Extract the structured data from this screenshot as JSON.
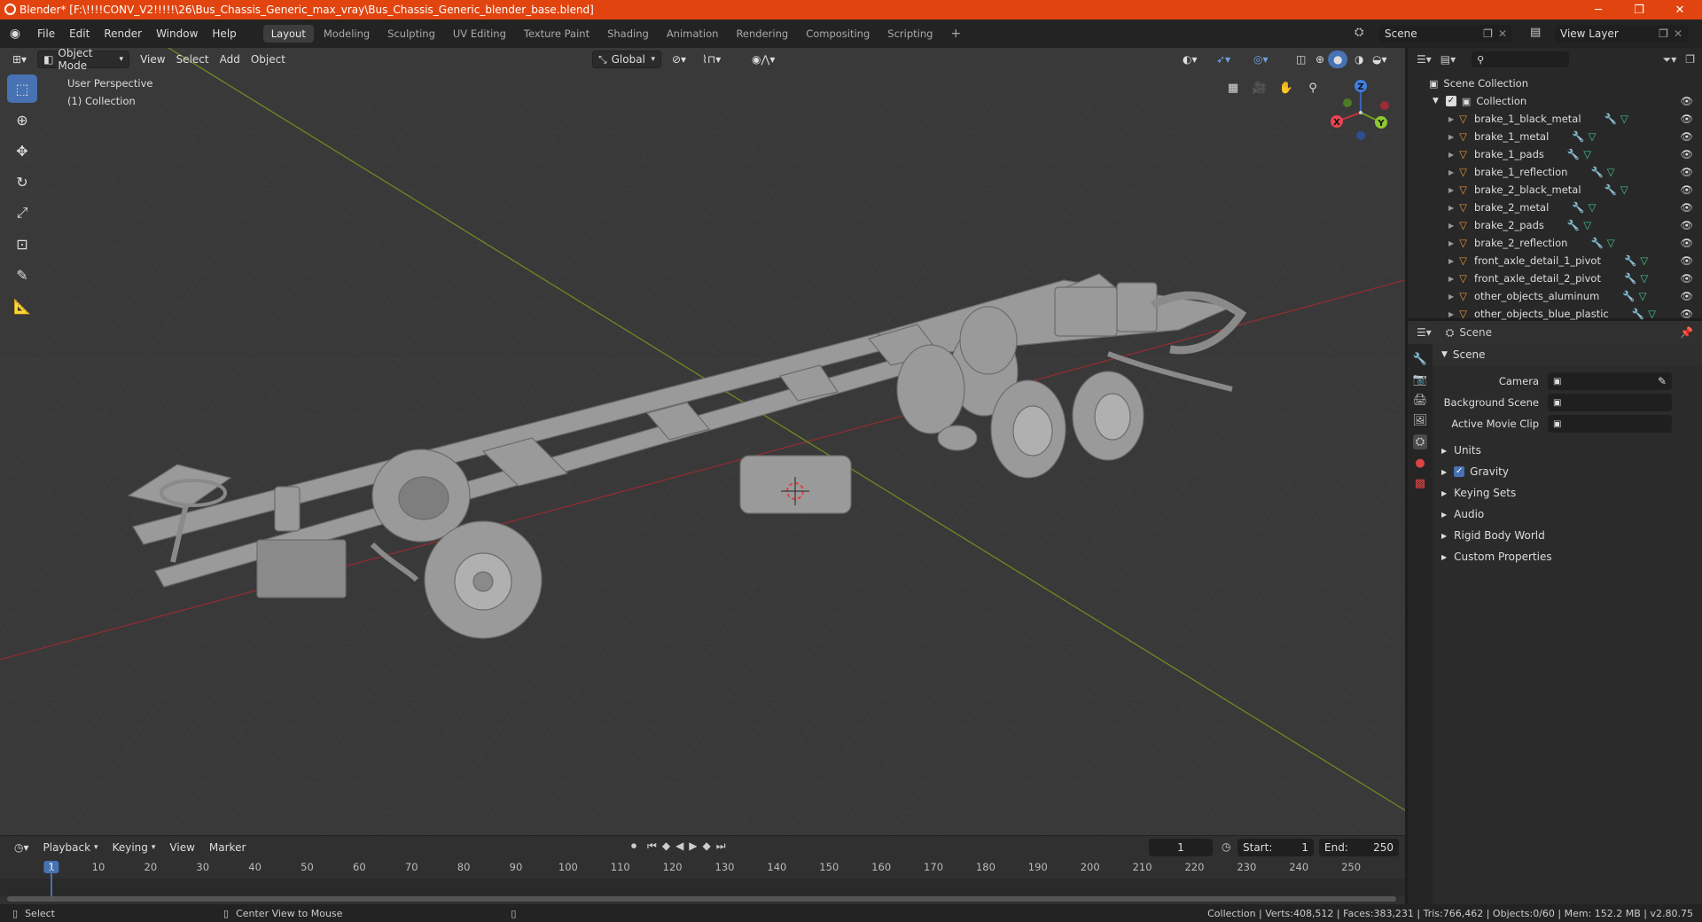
{
  "window": {
    "title": "Blender* [F:\\!!!!CONV_V2!!!!!\\26\\Bus_Chassis_Generic_max_vray\\Bus_Chassis_Generic_blender_base.blend]",
    "minimize": "─",
    "maximize": "❐",
    "close": "✕"
  },
  "menu": [
    "File",
    "Edit",
    "Render",
    "Window",
    "Help"
  ],
  "workspaces": [
    {
      "label": "Layout",
      "active": true
    },
    {
      "label": "Modeling"
    },
    {
      "label": "Sculpting"
    },
    {
      "label": "UV Editing"
    },
    {
      "label": "Texture Paint"
    },
    {
      "label": "Shading"
    },
    {
      "label": "Animation"
    },
    {
      "label": "Rendering"
    },
    {
      "label": "Compositing"
    },
    {
      "label": "Scripting"
    }
  ],
  "add_workspace": "+",
  "scene_field": "Scene",
  "view_layer_field": "View Layer",
  "viewport": {
    "mode": "Object Mode",
    "menus": [
      "View",
      "Select",
      "Add",
      "Object"
    ],
    "transform_orientation": "Global",
    "overlay_line1": "User Perspective",
    "overlay_line2": "(1) Collection",
    "gizmo": {
      "x": "X",
      "y": "Y",
      "z": "Z"
    }
  },
  "outliner": {
    "root": "Scene Collection",
    "collection": "Collection",
    "items": [
      "brake_1_black_metal",
      "brake_1_metal",
      "brake_1_pads",
      "brake_1_reflection",
      "brake_2_black_metal",
      "brake_2_metal",
      "brake_2_pads",
      "brake_2_reflection",
      "front_axle_detail_1_pivot",
      "front_axle_detail_2_pivot",
      "other_objects_aluminum",
      "other_objects_blue_plastic"
    ]
  },
  "properties": {
    "context": "Scene",
    "panel": "Scene",
    "fields": [
      {
        "label": "Camera",
        "value": ""
      },
      {
        "label": "Background Scene",
        "value": ""
      },
      {
        "label": "Active Movie Clip",
        "value": ""
      }
    ],
    "subpanels": [
      {
        "label": "Units",
        "checkbox": false
      },
      {
        "label": "Gravity",
        "checkbox": true
      },
      {
        "label": "Keying Sets",
        "checkbox": false
      },
      {
        "label": "Audio",
        "checkbox": false
      },
      {
        "label": "Rigid Body World",
        "checkbox": false
      },
      {
        "label": "Custom Properties",
        "checkbox": false
      }
    ]
  },
  "timeline": {
    "menus": [
      "Playback",
      "Keying",
      "View",
      "Marker"
    ],
    "current_frame": "1",
    "start_label": "Start:",
    "start": "1",
    "end_label": "End:",
    "end": "250",
    "ticks": [
      1,
      10,
      20,
      30,
      40,
      50,
      60,
      70,
      80,
      90,
      100,
      110,
      120,
      130,
      140,
      150,
      160,
      170,
      180,
      190,
      200,
      210,
      220,
      230,
      240,
      250
    ]
  },
  "status": {
    "left1": "Select",
    "left2": "Center View to Mouse",
    "right": "Collection | Verts:408,512 | Faces:383,231 | Tris:766,462 | Objects:0/60 | Mem: 152.2 MB | v2.80.75"
  },
  "colors": {
    "titlebar": "#e2440f",
    "accent": "#4772b3",
    "x_axis": "#8f2d33",
    "y_axis": "#6d8a23",
    "mesh_orange": "#e9923a",
    "modifier_blue": "#6a9fd8",
    "mesh_data_green": "#3fc98a"
  }
}
